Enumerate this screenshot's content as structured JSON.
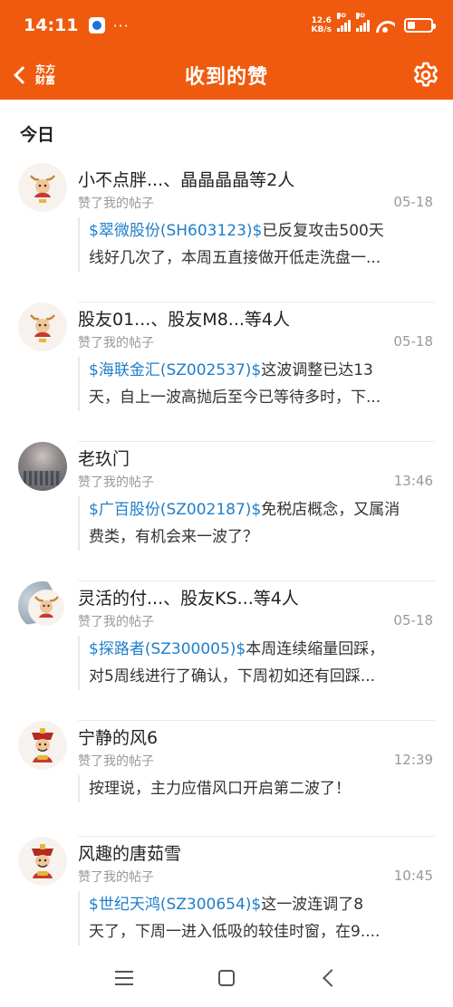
{
  "status_bar": {
    "time": "14:11",
    "more": "···",
    "net_speed_value": "12.6",
    "net_speed_unit": "KB/s",
    "signal_label": "HD",
    "battery_level": 0.35
  },
  "nav": {
    "brand_line1": "东方",
    "brand_line2": "财富",
    "title": "收到的赞"
  },
  "section": {
    "today_label": "今日"
  },
  "items": [
    {
      "title": "小不点胖...、晶晶晶晶等2人",
      "subtitle": "赞了我的帖子",
      "time": "05-18",
      "stock": "$翠微股份(SH603123)$",
      "text1": "已反复攻击500天",
      "text2": "线好几次了，本周五直接做开低走洗盘一..."
    },
    {
      "title": "股友01...、股友M8...等4人",
      "subtitle": "赞了我的帖子",
      "time": "05-18",
      "stock": "$海联金汇(SZ002537)$",
      "text1": "这波调整已达13",
      "text2": "天，自上一波高抛后至今已等待多时，下..."
    },
    {
      "title": "老玖门",
      "subtitle": "赞了我的帖子",
      "time": "13:46",
      "stock": "$广百股份(SZ002187)$",
      "text1": "免税店概念，又属消",
      "text2": "费类，有机会来一波了？"
    },
    {
      "title": "灵活的付...、股友KS...等4人",
      "subtitle": "赞了我的帖子",
      "time": "05-18",
      "stock": "$探路者(SZ300005)$",
      "text1": "本周连续缩量回踩，",
      "text2": "对5周线进行了确认，下周初如还有回踩..."
    },
    {
      "title": "宁静的风6",
      "subtitle": "赞了我的帖子",
      "time": "12:39",
      "stock": "",
      "text1": "按理说，主力应借风口开启第二波了！",
      "text2": ""
    },
    {
      "title": "风趣的唐茹雪",
      "subtitle": "赞了我的帖子",
      "time": "10:45",
      "stock": "$世纪天鸿(SZ300654)$",
      "text1": "这一波连调了8",
      "text2": "天了，下周一进入低吸的较佳时窗，在9...."
    }
  ],
  "colors": {
    "brand_orange": "#ef5a0e",
    "stock_link_blue": "#1f7ec8",
    "muted_gray": "#999999"
  }
}
